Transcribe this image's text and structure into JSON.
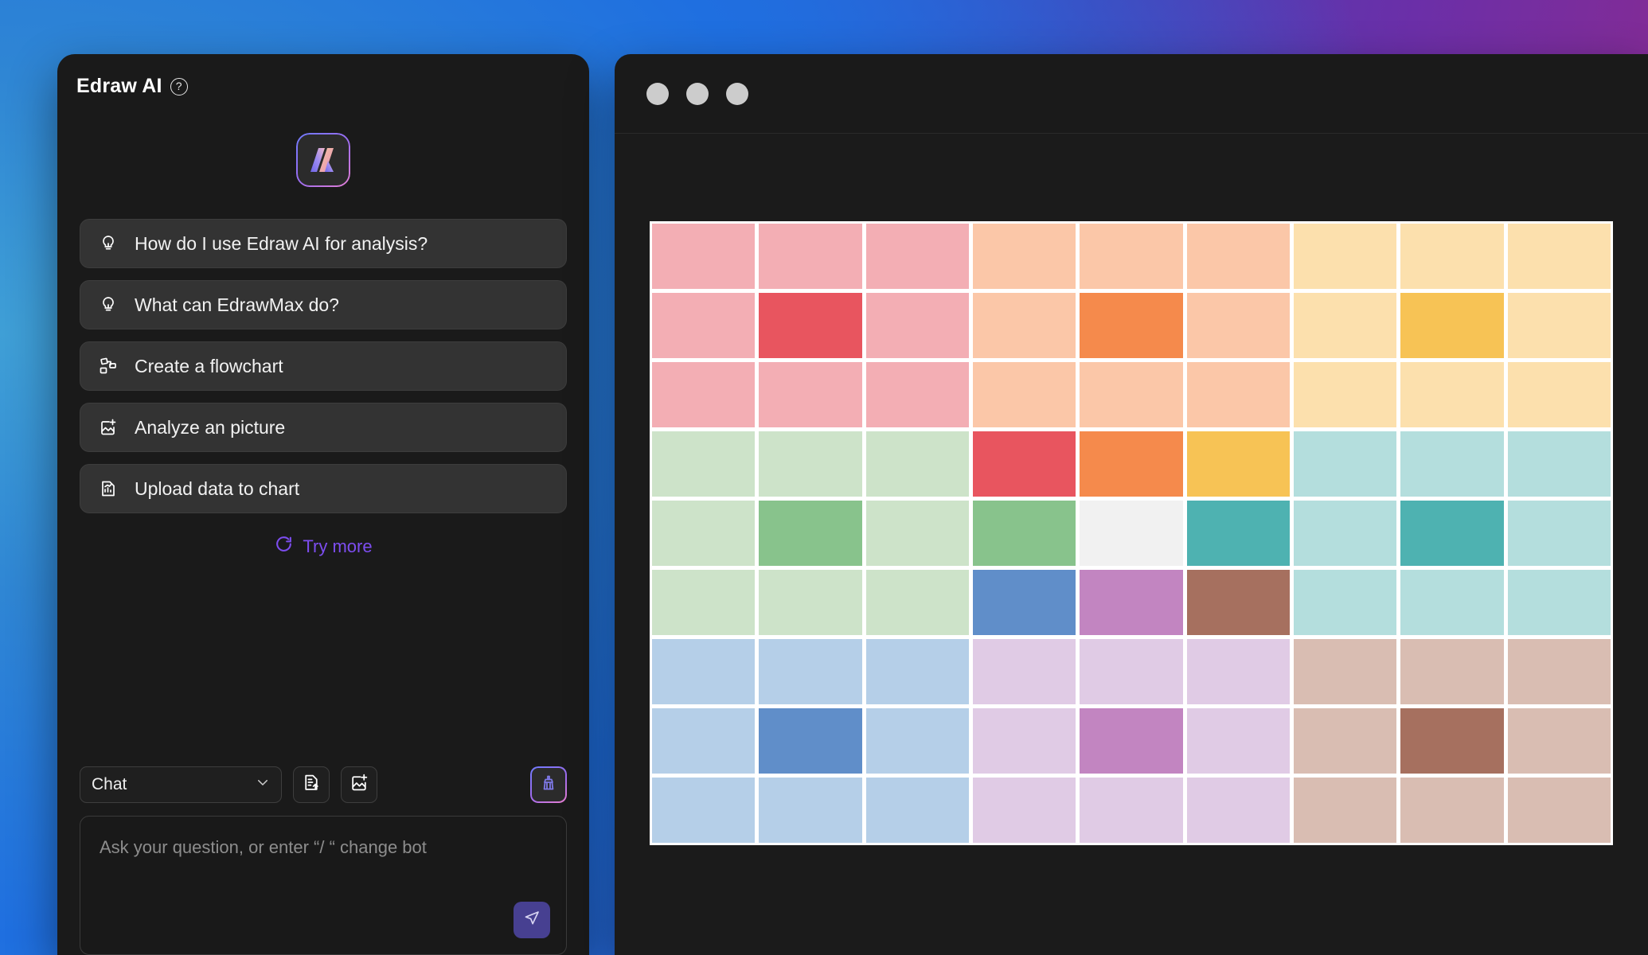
{
  "background": {
    "gradient_from": "#3aa0d8",
    "gradient_mid": "#4a3fb5",
    "gradient_to": "#8f2a8c"
  },
  "ai_panel": {
    "title": "Edraw AI",
    "help_icon": "question-mark-circle-icon",
    "logo_icon": "edraw-ai-logo-icon",
    "accent_color": "#7d4df0",
    "suggestions": [
      {
        "icon": "lightbulb-icon",
        "label": "How do I use Edraw AI for analysis?"
      },
      {
        "icon": "lightbulb-icon",
        "label": "What can EdrawMax do?"
      },
      {
        "icon": "flowchart-icon",
        "label": "Create a flowchart"
      },
      {
        "icon": "image-add-icon",
        "label": "Analyze an picture"
      },
      {
        "icon": "chart-file-icon",
        "label": "Upload data to chart"
      }
    ],
    "try_more": {
      "icon": "refresh-icon",
      "label": "Try more"
    },
    "composer": {
      "mode_value": "Chat",
      "mode_options": [
        "Chat"
      ],
      "chevron_icon": "chevron-down-icon",
      "upload_doc_icon": "document-upload-icon",
      "upload_image_icon": "image-add-icon",
      "clear_icon": "broom-icon",
      "placeholder": "Ask your question, or enter  “/ “ change bot",
      "send_icon": "send-icon",
      "send_bg": "#474091"
    }
  },
  "doc_window": {
    "titlebar": {
      "dots": [
        "window-dot-1",
        "window-dot-2",
        "window-dot-3"
      ],
      "dot_color": "#cccccc"
    }
  },
  "chart_data": {
    "type": "heatmap",
    "title": "",
    "xlabel": "",
    "ylabel": "",
    "rows": 9,
    "cols": 9,
    "grid_background": "#ffffff",
    "legend": [],
    "palette": {
      "pink_light": "#f3aeb4",
      "pink_strong": "#e8555f",
      "peach_light": "#fbc7a8",
      "peach_strong": "#f58a4c",
      "cream_light": "#fce0ad",
      "cream_strong": "#f7c355",
      "green_light": "#cde3c9",
      "green_strong": "#88c38c",
      "white_cell": "#f1f1f1",
      "teal_light": "#b4dedd",
      "teal_strong": "#4eb2b1",
      "blue_light": "#b5cfe8",
      "blue_strong": "#608ec9",
      "lilac_light": "#e0cbe5",
      "lilac_strong": "#c285c1",
      "brown_light": "#d9bdb2",
      "brown_strong": "#a6705f"
    },
    "cells": [
      [
        "#f3aeb4",
        "#f3aeb4",
        "#f3aeb4",
        "#fbc7a8",
        "#fbc7a8",
        "#fbc7a8",
        "#fce0ad",
        "#fce0ad",
        "#fce0ad"
      ],
      [
        "#f3aeb4",
        "#e8555f",
        "#f3aeb4",
        "#fbc7a8",
        "#f58a4c",
        "#fbc7a8",
        "#fce0ad",
        "#f7c355",
        "#fce0ad"
      ],
      [
        "#f3aeb4",
        "#f3aeb4",
        "#f3aeb4",
        "#fbc7a8",
        "#fbc7a8",
        "#fbc7a8",
        "#fce0ad",
        "#fce0ad",
        "#fce0ad"
      ],
      [
        "#cde3c9",
        "#cde3c9",
        "#cde3c9",
        "#e8555f",
        "#f58a4c",
        "#f7c355",
        "#b4dedd",
        "#b4dedd",
        "#b4dedd"
      ],
      [
        "#cde3c9",
        "#88c38c",
        "#cde3c9",
        "#88c38c",
        "#f1f1f1",
        "#4eb2b1",
        "#b4dedd",
        "#4eb2b1",
        "#b4dedd"
      ],
      [
        "#cde3c9",
        "#cde3c9",
        "#cde3c9",
        "#608ec9",
        "#c285c1",
        "#a6705f",
        "#b4dedd",
        "#b4dedd",
        "#b4dedd"
      ],
      [
        "#b5cfe8",
        "#b5cfe8",
        "#b5cfe8",
        "#e0cbe5",
        "#e0cbe5",
        "#e0cbe5",
        "#d9bdb2",
        "#d9bdb2",
        "#d9bdb2"
      ],
      [
        "#b5cfe8",
        "#608ec9",
        "#b5cfe8",
        "#e0cbe5",
        "#c285c1",
        "#e0cbe5",
        "#d9bdb2",
        "#a6705f",
        "#d9bdb2"
      ],
      [
        "#b5cfe8",
        "#b5cfe8",
        "#b5cfe8",
        "#e0cbe5",
        "#e0cbe5",
        "#e0cbe5",
        "#d9bdb2",
        "#d9bdb2",
        "#d9bdb2"
      ]
    ]
  }
}
